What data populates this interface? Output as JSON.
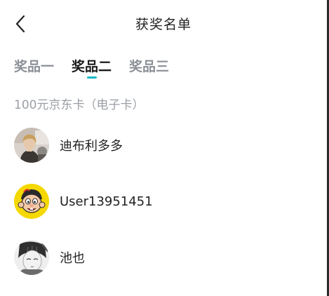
{
  "header": {
    "title": "获奖名单",
    "back_icon": "chevron-left-icon"
  },
  "tabs": [
    {
      "label": "奖品一",
      "active": false
    },
    {
      "label": "奖品二",
      "active": true
    },
    {
      "label": "奖品三",
      "active": false
    }
  ],
  "prize": {
    "name": "100元京东卡（电子卡）"
  },
  "winners": [
    {
      "name": "迪布利多多",
      "avatar": "photo-avatar"
    },
    {
      "name": "User13951451",
      "avatar": "cartoon-avatar"
    },
    {
      "name": "池也",
      "avatar": "sketch-avatar"
    }
  ],
  "colors": {
    "accent": "#19b8c6",
    "active_tab": "#1a1a1a",
    "inactive_tab": "#8c9096",
    "muted_text": "#9a9ea4",
    "cartoon_avatar_bg": "#f5d800"
  }
}
